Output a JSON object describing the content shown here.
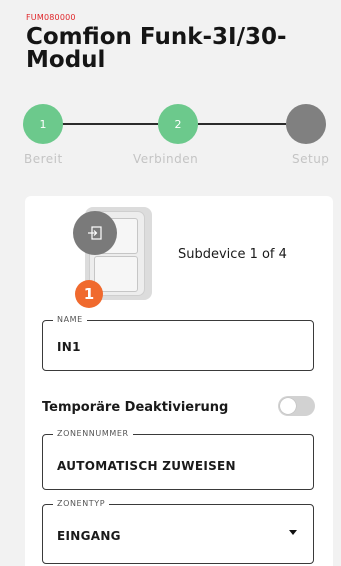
{
  "header": {
    "code": "FUM080000",
    "title": "Comfion Funk-3I/30-Modul"
  },
  "stepper": {
    "steps": [
      {
        "number": "1",
        "label": "Bereit",
        "state": "done"
      },
      {
        "number": "2",
        "label": "Verbinden",
        "state": "done"
      },
      {
        "number": "",
        "label": "Setup",
        "state": "pending"
      }
    ],
    "colors": {
      "done": "#6cc98c",
      "pending": "#808080"
    }
  },
  "device": {
    "badge_number": "1",
    "subdevice_text": "Subdevice 1 of 4",
    "icon": "enter-icon",
    "colors": {
      "badge": "#f06a2e",
      "icon_bg": "#7a7a7a"
    }
  },
  "form": {
    "name": {
      "label": "NAME",
      "value": "IN1"
    },
    "deactivate": {
      "label": "Temporäre Deaktivierung",
      "enabled": false
    },
    "zone_number": {
      "label": "ZONENNUMMER",
      "value": "AUTOMATISCH ZUWEISEN"
    },
    "zone_type": {
      "label": "ZONENTYP",
      "value": "EINGANG"
    }
  }
}
